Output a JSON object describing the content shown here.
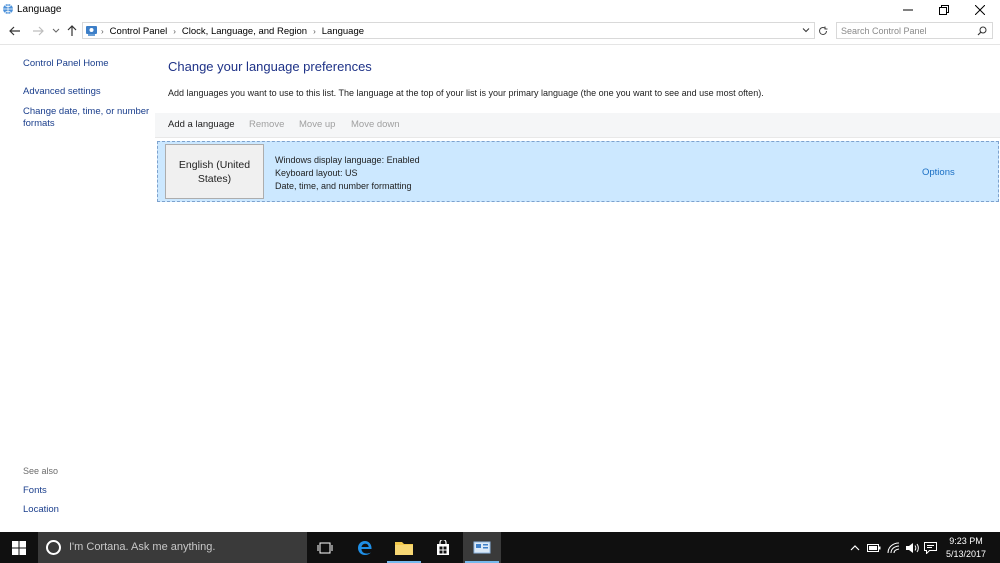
{
  "window": {
    "title": "Language"
  },
  "address": {
    "crumbs": [
      "Control Panel",
      "Clock, Language, and Region",
      "Language"
    ],
    "search_placeholder": "Search Control Panel"
  },
  "sidebar": {
    "items": [
      {
        "label": "Control Panel Home"
      },
      {
        "label": "Advanced settings"
      },
      {
        "label": "Change date, time, or number formats"
      }
    ],
    "see_also_label": "See also",
    "see_also_items": [
      {
        "label": "Fonts"
      },
      {
        "label": "Location"
      }
    ]
  },
  "main": {
    "title": "Change your language preferences",
    "description": "Add languages you want to use to this list. The language at the top of your list is your primary language (the one you want to see and use most often).",
    "toolbar": {
      "add": "Add a language",
      "remove": "Remove",
      "move_up": "Move up",
      "move_down": "Move down"
    },
    "languages": [
      {
        "name": "English (United States)",
        "details": [
          "Windows display language: Enabled",
          "Keyboard layout: US",
          "Date, time, and number formatting"
        ],
        "options_label": "Options"
      }
    ]
  },
  "taskbar": {
    "cortana_placeholder": "I'm Cortana. Ask me anything.",
    "time": "9:23 PM",
    "date": "5/13/2017"
  },
  "colors": {
    "link": "#1a3e8c",
    "title": "#1e3287",
    "selection": "#cce8ff",
    "taskbar": "#101010",
    "accent": "#76b9ed"
  }
}
